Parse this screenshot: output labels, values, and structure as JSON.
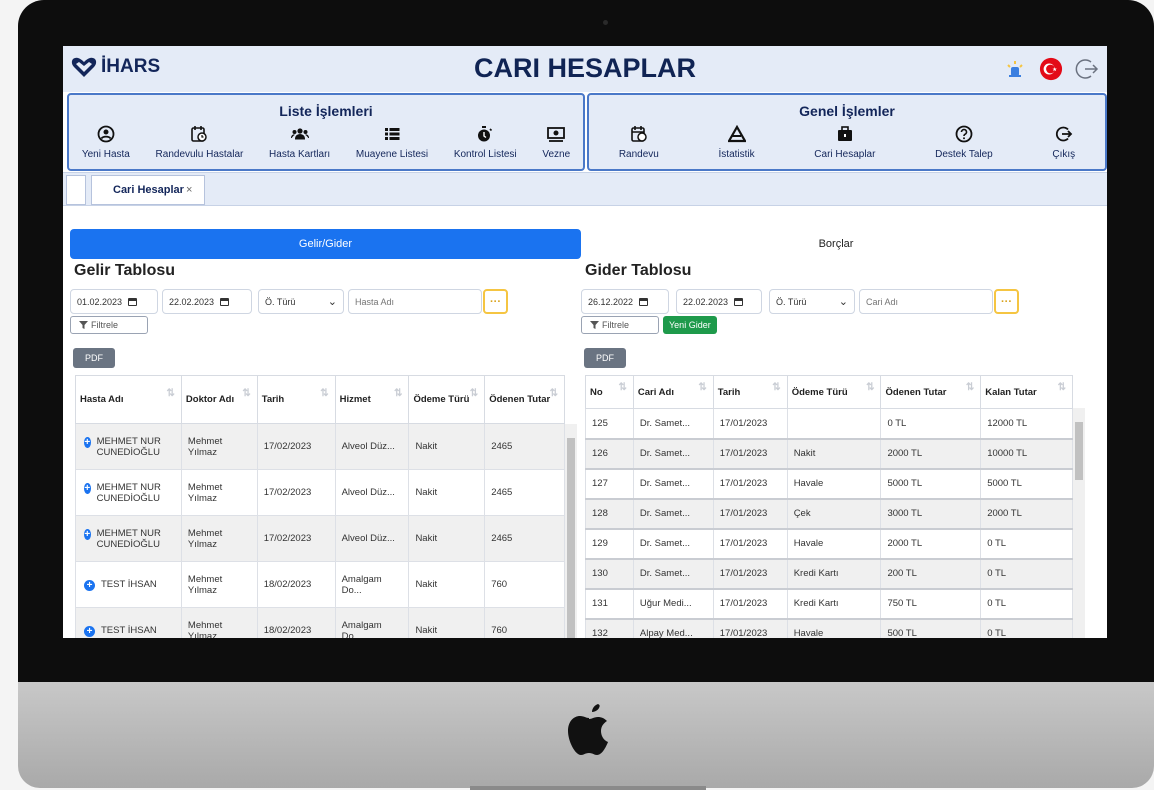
{
  "app": {
    "logo_text": "İHARS",
    "title": "CARI HESAPLAR"
  },
  "menu": {
    "left_title": "Liste İşlemleri",
    "left_items": [
      "Yeni Hasta",
      "Randevulu Hastalar",
      "Hasta Kartları",
      "Muayene Listesi",
      "Kontrol Listesi",
      "Vezne"
    ],
    "right_title": "Genel İşlemler",
    "right_items": [
      "Randevu",
      "İstatistik",
      "Cari Hesaplar",
      "Destek Talep",
      "Çıkış"
    ]
  },
  "tabs": {
    "active_label": "Cari Hesaplar",
    "close_glyph": "×"
  },
  "segments": {
    "active": "Gelir/Gider",
    "inactive": "Borçlar"
  },
  "left_panel": {
    "title": "Gelir Tablosu",
    "start_date": "01.02.2023",
    "end_date": "22.02.2023",
    "payment_select": "Ö. Türü",
    "search_placeholder": "Hasta Adı",
    "dots": "···",
    "filter_label": "Filtrele",
    "pdf_label": "PDF",
    "columns": [
      "Hasta Adı",
      "Doktor Adı",
      "Tarih",
      "Hizmet",
      "Ödeme Türü",
      "Ödenen Tutar"
    ],
    "rows": [
      {
        "patient": "MEHMET NUR CUNEDİOĞLU",
        "doctor": "Mehmet Yılmaz",
        "date": "17/02/2023",
        "service": "Alveol Düz...",
        "payment": "Nakit",
        "amount": "2465"
      },
      {
        "patient": "MEHMET NUR CUNEDİOĞLU",
        "doctor": "Mehmet Yılmaz",
        "date": "17/02/2023",
        "service": "Alveol Düz...",
        "payment": "Nakit",
        "amount": "2465"
      },
      {
        "patient": "MEHMET NUR CUNEDİOĞLU",
        "doctor": "Mehmet Yılmaz",
        "date": "17/02/2023",
        "service": "Alveol Düz...",
        "payment": "Nakit",
        "amount": "2465"
      },
      {
        "patient": "TEST İHSAN",
        "doctor": "Mehmet Yılmaz",
        "date": "18/02/2023",
        "service": "Amalgam Do...",
        "payment": "Nakit",
        "amount": "760"
      },
      {
        "patient": "TEST İHSAN",
        "doctor": "Mehmet Yılmaz",
        "date": "18/02/2023",
        "service": "Amalgam Do...",
        "payment": "Nakit",
        "amount": "760"
      }
    ]
  },
  "right_panel": {
    "title": "Gider Tablosu",
    "start_date": "26.12.2022",
    "end_date": "22.02.2023",
    "payment_select": "Ö. Türü",
    "search_placeholder": "Cari Adı",
    "dots": "···",
    "filter_label": "Filtrele",
    "new_label": "Yeni Gider",
    "pdf_label": "PDF",
    "columns": [
      "No",
      "Cari Adı",
      "Tarih",
      "Ödeme Türü",
      "Ödenen Tutar",
      "Kalan Tutar"
    ],
    "rows": [
      {
        "no": "125",
        "name": "Dr. Samet...",
        "date": "17/01/2023",
        "payment": "",
        "paid": "0 TL",
        "remaining": "12000 TL"
      },
      {
        "no": "126",
        "name": "Dr. Samet...",
        "date": "17/01/2023",
        "payment": "Nakit",
        "paid": "2000 TL",
        "remaining": "10000 TL"
      },
      {
        "no": "127",
        "name": "Dr. Samet...",
        "date": "17/01/2023",
        "payment": "Havale",
        "paid": "5000 TL",
        "remaining": "5000 TL"
      },
      {
        "no": "128",
        "name": "Dr. Samet...",
        "date": "17/01/2023",
        "payment": "Çek",
        "paid": "3000 TL",
        "remaining": "2000 TL"
      },
      {
        "no": "129",
        "name": "Dr. Samet...",
        "date": "17/01/2023",
        "payment": "Havale",
        "paid": "2000 TL",
        "remaining": "0 TL"
      },
      {
        "no": "130",
        "name": "Dr. Samet...",
        "date": "17/01/2023",
        "payment": "Kredi Kartı",
        "paid": "200 TL",
        "remaining": "0 TL"
      },
      {
        "no": "131",
        "name": "Uğur Medi...",
        "date": "17/01/2023",
        "payment": "Kredi Kartı",
        "paid": "750 TL",
        "remaining": "0 TL"
      },
      {
        "no": "132",
        "name": "Alpay Med...",
        "date": "17/01/2023",
        "payment": "Havale",
        "paid": "500 TL",
        "remaining": "0 TL"
      }
    ]
  },
  "colors": {
    "primary": "#1a73f0",
    "navy": "#13265a",
    "header_bg": "#e4ebf7",
    "menu_border": "#4a78c8",
    "green": "#1e9a4b",
    "accent_yellow": "#f5c542",
    "flag_red": "#e30a17"
  },
  "icons": [
    "heart-logo-icon",
    "light-icon",
    "turkey-flag-icon",
    "logout-icon",
    "user-circle-icon",
    "calendar-clock-icon",
    "users-icon",
    "list-icon",
    "stopwatch-icon",
    "money-icon",
    "calendar-icon",
    "chart-icon",
    "briefcase-icon",
    "help-icon",
    "exit-icon",
    "plus-circle-icon",
    "sort-icon",
    "filter-icon",
    "calendar-small-icon",
    "apple-logo-icon"
  ]
}
